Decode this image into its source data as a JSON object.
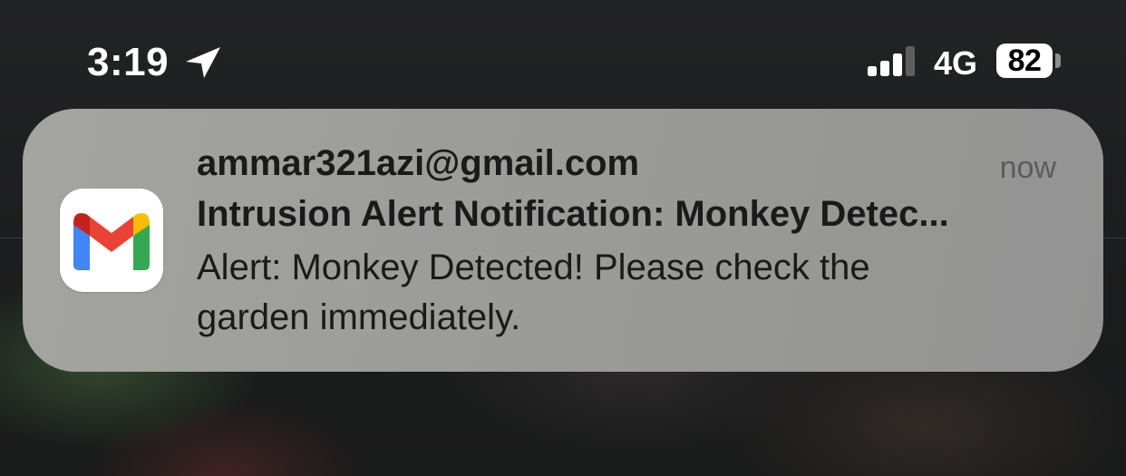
{
  "status_bar": {
    "time": "3:19",
    "location_icon": "location-arrow-icon",
    "signal_icon": "cellular-signal-icon",
    "signal_bars_active": 3,
    "signal_bars_total": 4,
    "network": "4G",
    "battery_level": "82",
    "battery_icon": "battery-icon"
  },
  "notification": {
    "app_icon": "gmail-icon",
    "sender": "ammar321azi@gmail.com",
    "timestamp": "now",
    "subject": "Intrusion Alert Notification: Monkey Detec...",
    "body_line1": "Alert: Monkey Detected! Please check the",
    "body_line2": "garden immediately."
  },
  "colors": {
    "gmail_red": "#EA4335",
    "gmail_dark_red": "#C5221F",
    "gmail_blue": "#4285F4",
    "gmail_green": "#34A853",
    "gmail_yellow": "#FBBC04"
  }
}
